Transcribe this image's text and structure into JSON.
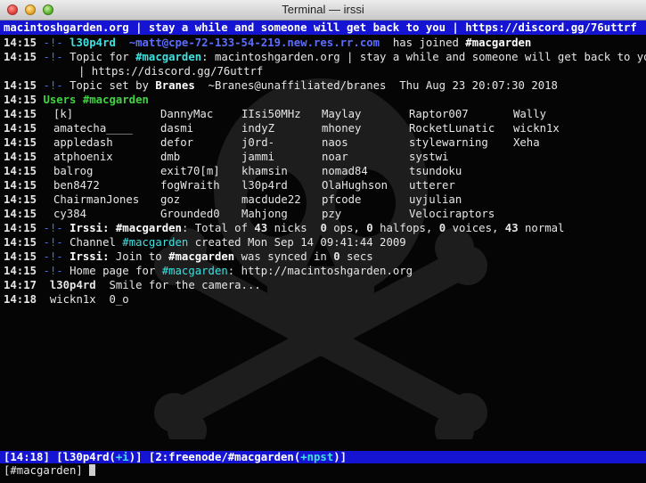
{
  "window": {
    "title": "Terminal — irssi"
  },
  "topic_bar": {
    "text": "macintoshgarden.org | stay a while and someone will get back to you | https://discord.gg/76uttrf"
  },
  "log": {
    "l1": {
      "time": "14:15",
      "nick": "l30p4rd",
      "host": "~matt@cpe-72-133-54-219.new.res.rr.com",
      "text": "has joined",
      "channel": "#macgarden"
    },
    "l2": {
      "time": "14:15",
      "pre": "Topic for",
      "channel": "#macgarden",
      "text": ": macintoshgarden.org | stay a while and someone will get back to you"
    },
    "l3": {
      "text": "| https://discord.gg/76uttrf"
    },
    "l4": {
      "time": "14:15",
      "pre": "Topic set by",
      "nick": "Branes",
      "host": "~Branes@unaffiliated/branes",
      "date": "Thu Aug 23 20:07:30 2018"
    },
    "l5": {
      "time": "14:15",
      "text": "Users #macgarden"
    },
    "l16": {
      "time": "14:15",
      "pre": "Irssi:",
      "channel": "#macgarden",
      "pre2": ": Total of",
      "n1": "43",
      "mid1": "nicks",
      "n2": "0",
      "mid2": "ops,",
      "n3": "0",
      "mid3": "halfops,",
      "n4": "0",
      "mid4": "voices,",
      "n5": "43",
      "mid5": "normal"
    },
    "l17": {
      "time": "14:15",
      "pre": "Channel",
      "channel": "#macgarden",
      "text": "created Mon Sep 14 09:41:44 2009"
    },
    "l18": {
      "time": "14:15",
      "pre": "Irssi:",
      "mid": "Join to",
      "channel": "#macgarden",
      "mid2": "was synced in",
      "n": "0",
      "end": "secs"
    },
    "l19": {
      "time": "14:15",
      "pre": "Home page for",
      "channel": "#macgarden",
      "text": ": http://macintoshgarden.org"
    },
    "l20": {
      "time": "14:17",
      "nick": "l30p4rd",
      "text": "Smile for the camera..."
    },
    "l21": {
      "time": "14:18",
      "nick": "wickn1x",
      "text": "0_o"
    }
  },
  "markers": {
    "arrow": "-!-"
  },
  "users": [
    [
      "[k]",
      "DannyMac",
      "IIsi50MHz",
      "Maylay",
      "Raptor007",
      "Wally"
    ],
    [
      "amatecha____",
      "dasmi",
      "indyZ",
      "mhoney",
      "RocketLunatic",
      "wickn1x"
    ],
    [
      "appledash",
      "defor",
      "j0rd-",
      "naos",
      "stylewarning",
      "Xeha"
    ],
    [
      "atphoenix",
      "dmb",
      "jammi",
      "noar",
      "systwi",
      ""
    ],
    [
      "balrog",
      "exit70[m]",
      "khamsin",
      "nomad84",
      "tsundoku",
      ""
    ],
    [
      "ben8472",
      "fogWraith",
      "l30p4rd",
      "OlaHughson",
      "utterer",
      ""
    ],
    [
      "ChairmanJones",
      "goz",
      "macdude22",
      "pfcode",
      "uyjulian",
      ""
    ],
    [
      "cy384",
      "Grounded0",
      "Mahjong",
      "pzy",
      "Velociraptors",
      ""
    ]
  ],
  "user_times": [
    "14:15",
    "14:15",
    "14:15",
    "14:15",
    "14:15",
    "14:15",
    "14:15",
    "14:15"
  ],
  "status_bar": {
    "time": "14:18",
    "nick": "l30p4rd",
    "mode": "+i",
    "window": "2:freenode/#macgarden",
    "chanmode": "+npst"
  },
  "input": {
    "prompt": "[#macgarden]"
  },
  "colors": {
    "status_bg": "#1414d2",
    "channel": "#40e0e0",
    "users_header": "#3fd33f",
    "background": "#050505"
  },
  "icons": [
    "close-button-icon",
    "minimize-button-icon",
    "zoom-button-icon",
    "skull-crossbones-watermark-icon"
  ]
}
